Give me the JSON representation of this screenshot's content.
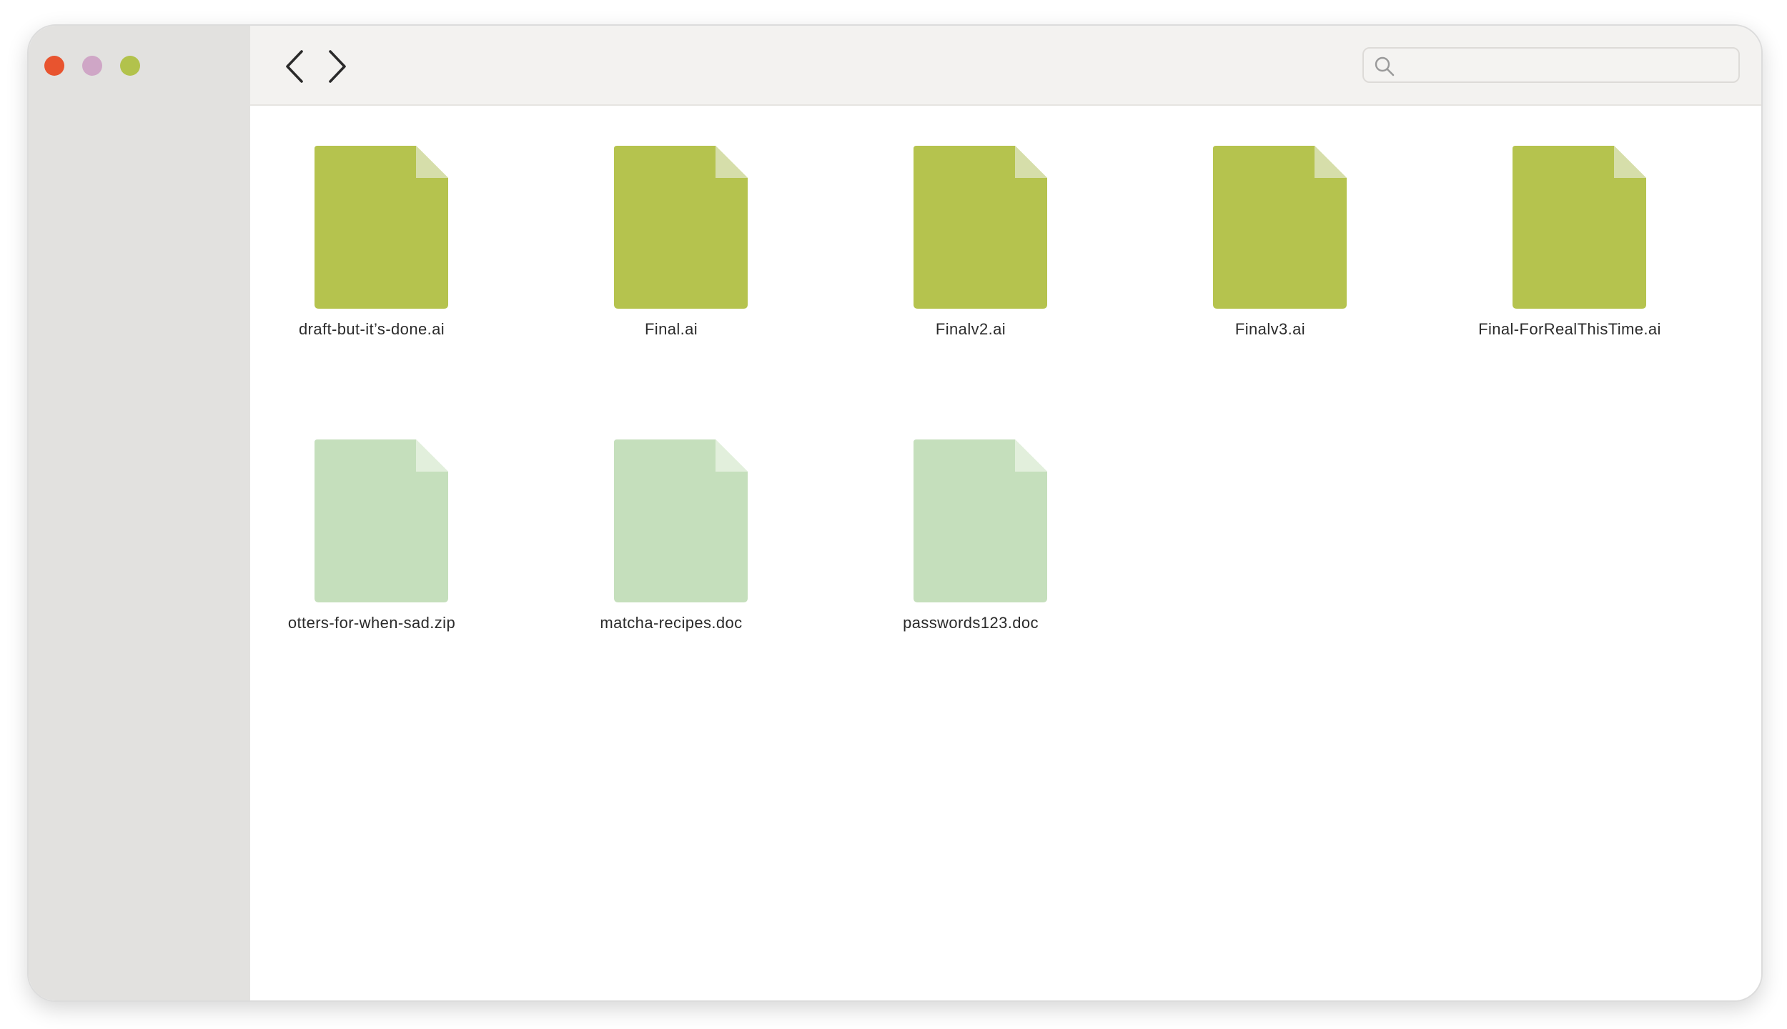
{
  "window": {
    "traffic_lights": [
      {
        "name": "close",
        "color": "#e8542f"
      },
      {
        "name": "minimize",
        "color": "#cfa6c6"
      },
      {
        "name": "zoom",
        "color": "#b2c24c"
      }
    ]
  },
  "toolbar": {
    "back_icon": "chevron-left-icon",
    "forward_icon": "chevron-right-icon",
    "search": {
      "icon": "search-icon",
      "placeholder": "",
      "value": ""
    }
  },
  "colors": {
    "ai_file": "#b5c34e",
    "ai_fold": "#d6deaa",
    "doc_file": "#c5dfbc",
    "doc_fold": "#e2efdc"
  },
  "files": [
    {
      "name": "draft-but-it’s-done.ai",
      "kind": "ai"
    },
    {
      "name": "Final.ai",
      "kind": "ai"
    },
    {
      "name": "Finalv2.ai",
      "kind": "ai"
    },
    {
      "name": "Finalv3.ai",
      "kind": "ai"
    },
    {
      "name": "Final-ForRealThisTime.ai",
      "kind": "ai"
    },
    {
      "name": "otters-for-when-sad.zip",
      "kind": "doc"
    },
    {
      "name": "matcha-recipes.doc",
      "kind": "doc"
    },
    {
      "name": "passwords123.doc",
      "kind": "doc"
    }
  ]
}
